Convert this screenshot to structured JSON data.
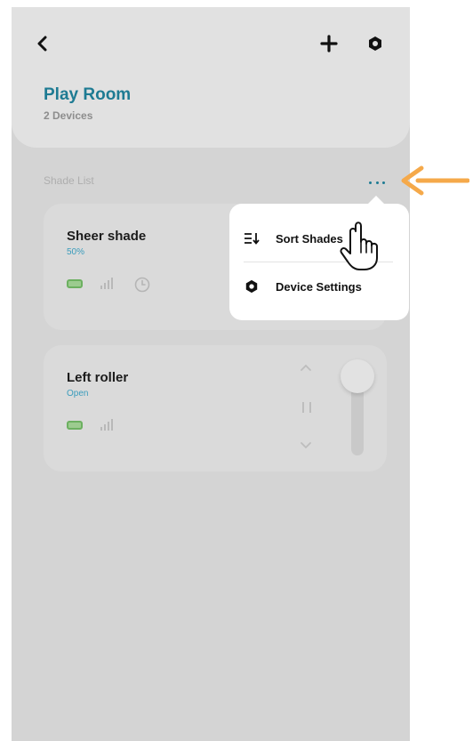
{
  "header": {
    "back_icon": "chevron-left-icon",
    "add_icon": "plus-icon",
    "settings_icon": "hexagon-settings-icon",
    "room_title": "Play Room",
    "device_count": "2 Devices"
  },
  "shade_list": {
    "label": "Shade List",
    "more_icon": "ellipsis-icon",
    "items": [
      {
        "name": "Sheer shade",
        "status": "50%",
        "icons": [
          "battery-icon",
          "signal-icon",
          "clock-icon"
        ]
      },
      {
        "name": "Left roller",
        "status": "Open",
        "icons": [
          "battery-icon",
          "signal-icon"
        ],
        "controls": [
          "chevron-up-icon",
          "pause-icon",
          "chevron-down-icon"
        ],
        "slider_position": 1.0
      }
    ]
  },
  "dropdown_menu": {
    "items": [
      {
        "label": "Sort Shades",
        "icon": "sort-icon"
      },
      {
        "label": "Device Settings",
        "icon": "hexagon-settings-icon"
      }
    ]
  },
  "colors": {
    "accent": "#1e7b93",
    "status_text": "#3a9cbc",
    "battery": "#6cb060",
    "annotation_arrow": "#f5a94a",
    "overlay_background": "#d4d4d4"
  }
}
